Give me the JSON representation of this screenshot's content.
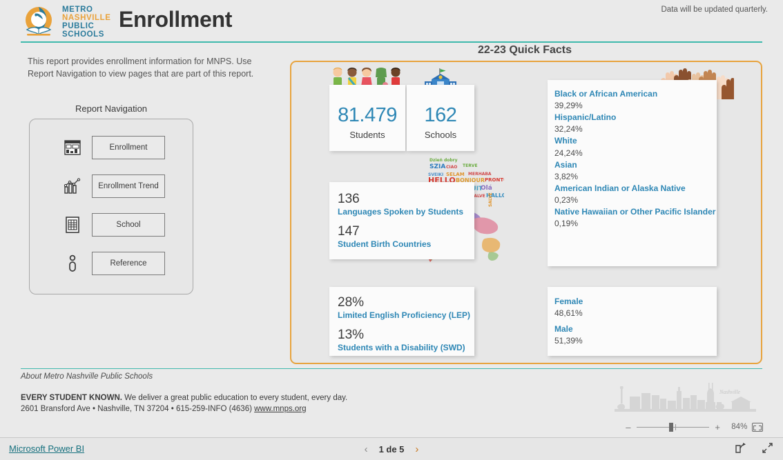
{
  "header": {
    "title": "Enrollment",
    "logo": {
      "line1": "METRO",
      "line2": "NASHVILLE",
      "line3": "PUBLIC",
      "line4": "SCHOOLS",
      "icon": "mnps-logo-icon"
    },
    "note": "Data will be updated quarterly."
  },
  "left": {
    "intro": "This report provides enrollment information for MNPS. Use Report Navigation to view pages that are part of this report.",
    "nav_title": "Report Navigation",
    "nav_items": [
      {
        "label": "Enrollment",
        "icon": "dashboard-icon"
      },
      {
        "label": "Enrollment Trend",
        "icon": "line-bar-chart-icon"
      },
      {
        "label": "School",
        "icon": "table-document-icon"
      },
      {
        "label": "Reference",
        "icon": "info-pin-icon"
      }
    ]
  },
  "quick_facts": {
    "title": "22-23 Quick Facts",
    "stats": [
      {
        "value": "81.479",
        "label": "Students",
        "icon": "children-group-icon"
      },
      {
        "value": "162",
        "label": "Schools",
        "icon": "school-building-icon"
      }
    ],
    "language_card": [
      {
        "value": "136",
        "label": "Languages Spoken by Students"
      },
      {
        "value": "147",
        "label": "Student Birth Countries"
      }
    ],
    "program_card": [
      {
        "value": "28%",
        "label": "Limited English Proficiency (LEP)"
      },
      {
        "value": "13%",
        "label": "Students with a Disability (SWD)"
      }
    ],
    "race_card": [
      {
        "name": "Black or African American",
        "value": "39,29%"
      },
      {
        "name": "Hispanic/Latino",
        "value": "32,24%"
      },
      {
        "name": "White",
        "value": "24,24%"
      },
      {
        "name": "Asian",
        "value": "3,82%"
      },
      {
        "name": "American Indian or Alaska Native",
        "value": "0,23%"
      },
      {
        "name": "Native Hawaiian or Other Pacific Islander",
        "value": "0,19%"
      }
    ],
    "gender_card": [
      {
        "name": "Female",
        "value": "48,61%"
      },
      {
        "name": "Male",
        "value": "51,39%"
      }
    ],
    "images": {
      "wordcloud": "hello-languages-wordcloud-image",
      "worldmap": "watercolor-world-map-image",
      "hands": "raised-hands-diversity-image"
    }
  },
  "footer": {
    "about_link": "About Metro Nashville Public Schools",
    "tagline_bold": "EVERY STUDENT KNOWN.",
    "tagline_rest": " We deliver a great public education to every student, every day.",
    "address": "2601 Bransford Ave • Nashville, TN 37204 • 615-259-INFO (4636)",
    "website": "www.mnps.org",
    "skyline_alt": "nashville-skyline-image",
    "skyline_caption": "Nashville"
  },
  "zoom_bar": {
    "minus": "–",
    "plus": "+",
    "percent": "84%",
    "fit_icon": "fit-to-page-icon"
  },
  "status_bar": {
    "power_bi": "Microsoft Power BI",
    "prev_icon": "chevron-left-icon",
    "next_icon": "chevron-right-icon",
    "page_text": "1 de 5",
    "share_icon": "share-icon",
    "fullscreen_icon": "fullscreen-icon"
  },
  "colors": {
    "accent_teal": "#3fb9ac",
    "accent_blue": "#2e87b5",
    "accent_gold": "#e8a33d",
    "link": "#16707e"
  }
}
